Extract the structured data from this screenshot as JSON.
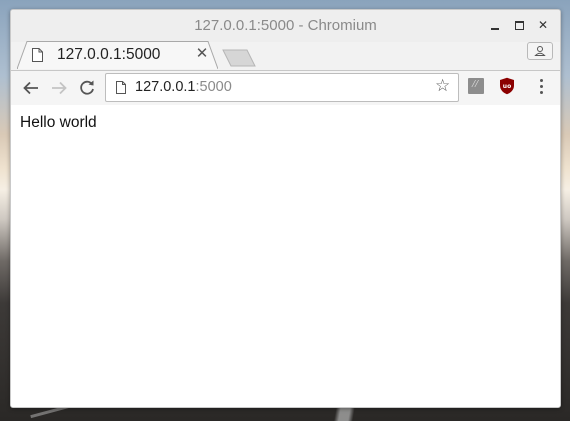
{
  "window": {
    "title": "127.0.0.1:5000 - Chromium"
  },
  "tabs": [
    {
      "title": "127.0.0.1:5000"
    }
  ],
  "omnibox": {
    "host": "127.0.0.1",
    "port": ":5000"
  },
  "page": {
    "text": "Hello world"
  },
  "colors": {
    "window_frame": "#eeeeee",
    "ublock_red": "#8b0000"
  },
  "icons": [
    "minimize-icon",
    "maximize-icon",
    "close-icon",
    "page-icon",
    "tab-close-icon",
    "new-tab-icon",
    "profile-icon",
    "back-arrow-icon",
    "forward-arrow-icon",
    "reload-icon",
    "star-icon",
    "extension-icon",
    "ublock-icon",
    "menu-icon"
  ]
}
